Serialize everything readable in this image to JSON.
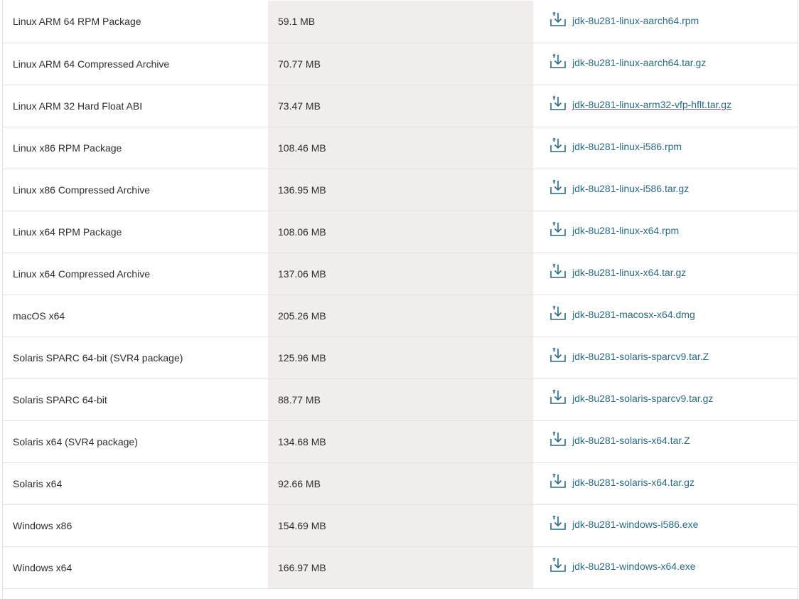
{
  "rows": [
    {
      "product": "Linux ARM 64 RPM Package",
      "size": "59.1 MB",
      "file": "jdk-8u281-linux-aarch64.rpm",
      "hover": false
    },
    {
      "product": "Linux ARM 64 Compressed Archive",
      "size": "70.77 MB",
      "file": "jdk-8u281-linux-aarch64.tar.gz",
      "hover": false
    },
    {
      "product": "Linux ARM 32 Hard Float ABI",
      "size": "73.47 MB",
      "file": "jdk-8u281-linux-arm32-vfp-hflt.tar.gz",
      "hover": true
    },
    {
      "product": "Linux x86 RPM Package",
      "size": "108.46 MB",
      "file": "jdk-8u281-linux-i586.rpm",
      "hover": false
    },
    {
      "product": "Linux x86 Compressed Archive",
      "size": "136.95 MB",
      "file": "jdk-8u281-linux-i586.tar.gz",
      "hover": false
    },
    {
      "product": "Linux x64 RPM Package",
      "size": "108.06 MB",
      "file": "jdk-8u281-linux-x64.rpm",
      "hover": false
    },
    {
      "product": "Linux x64 Compressed Archive",
      "size": "137.06 MB",
      "file": "jdk-8u281-linux-x64.tar.gz",
      "hover": false
    },
    {
      "product": "macOS x64",
      "size": "205.26 MB",
      "file": "jdk-8u281-macosx-x64.dmg",
      "hover": false
    },
    {
      "product": "Solaris SPARC 64-bit (SVR4 package)",
      "size": "125.96 MB",
      "file": "jdk-8u281-solaris-sparcv9.tar.Z",
      "hover": false
    },
    {
      "product": "Solaris SPARC 64-bit",
      "size": "88.77 MB",
      "file": "jdk-8u281-solaris-sparcv9.tar.gz",
      "hover": false
    },
    {
      "product": "Solaris x64 (SVR4 package)",
      "size": "134.68 MB",
      "file": "jdk-8u281-solaris-x64.tar.Z",
      "hover": false
    },
    {
      "product": "Solaris x64",
      "size": "92.66 MB",
      "file": "jdk-8u281-solaris-x64.tar.gz",
      "hover": false
    },
    {
      "product": "Windows x86",
      "size": "154.69 MB",
      "file": "jdk-8u281-windows-i586.exe",
      "hover": false
    },
    {
      "product": "Windows x64",
      "size": "166.97 MB",
      "file": "jdk-8u281-windows-x64.exe",
      "hover": false
    }
  ],
  "icons": {
    "download": "download-icon"
  },
  "colors": {
    "link": "#2b6a83",
    "icon": "#2b6a83",
    "size_column_bg": "#efeeec",
    "row_border": "#e3e1de",
    "text": "#312d2a"
  }
}
